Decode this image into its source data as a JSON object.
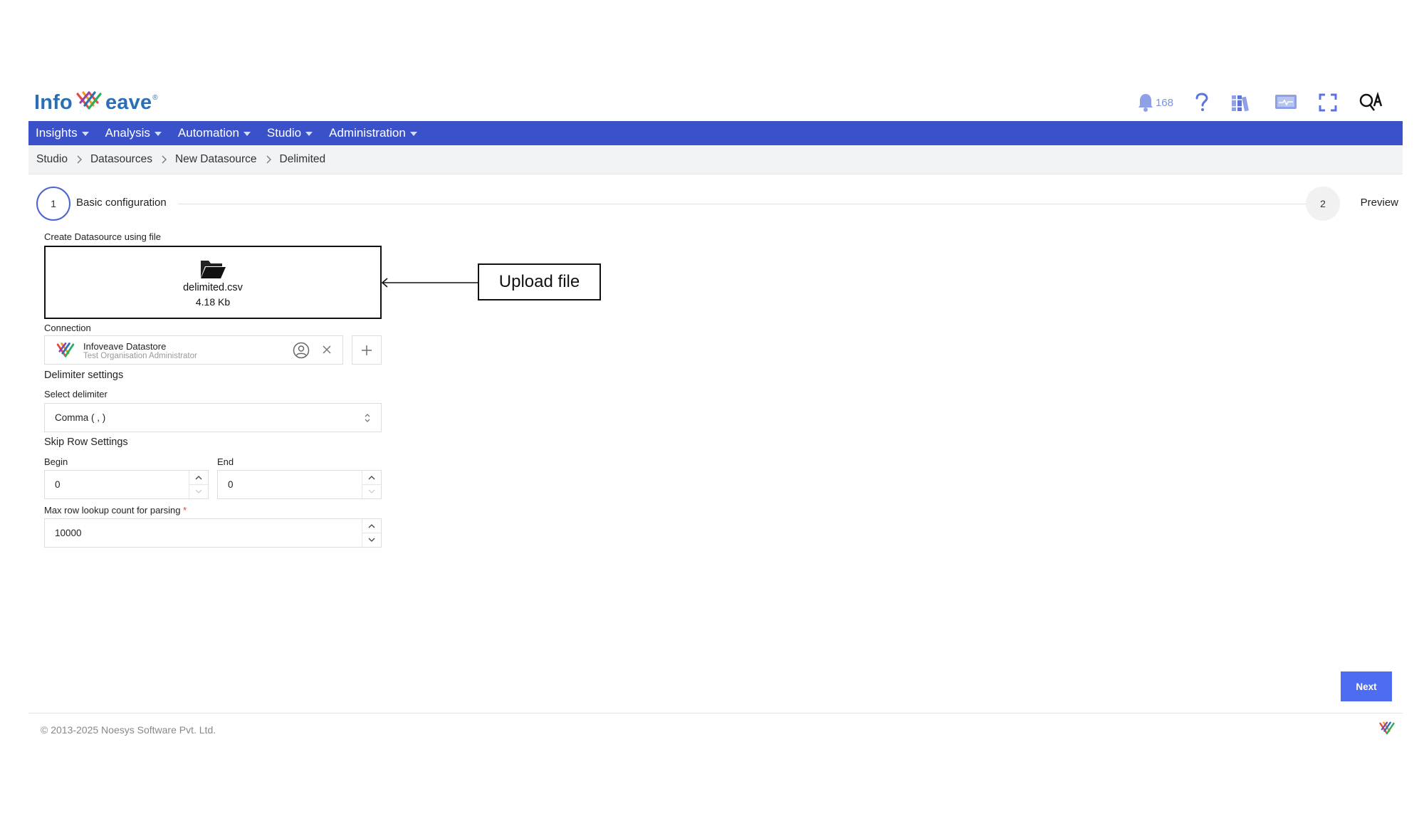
{
  "header": {
    "logo_text_left": "Info",
    "logo_text_right": "eave",
    "logo_reg": "®",
    "notification_count": "168"
  },
  "nav": {
    "items": [
      {
        "label": "Insights"
      },
      {
        "label": "Analysis"
      },
      {
        "label": "Automation"
      },
      {
        "label": "Studio"
      },
      {
        "label": "Administration"
      }
    ]
  },
  "breadcrumb": [
    "Studio",
    "Datasources",
    "New Datasource",
    "Delimited"
  ],
  "stepper": {
    "step1_number": "1",
    "step1_label": "Basic configuration",
    "step2_number": "2",
    "step2_label": "Preview"
  },
  "form": {
    "upload_label": "Create Datasource using file",
    "file_name": "delimited.csv",
    "file_size": "4.18 Kb",
    "connection_label": "Connection",
    "connection_name": "Infoveave Datastore",
    "connection_owner": "Test Organisation Administrator",
    "delimiter_settings_title": "Delimiter settings",
    "select_delimiter_label": "Select delimiter",
    "select_delimiter_value": "Comma ( , )",
    "skip_row_title": "Skip Row Settings",
    "begin_label": "Begin",
    "begin_value": "0",
    "end_label": "End",
    "end_value": "0",
    "max_row_label": "Max row lookup count for parsing",
    "max_row_required": "*",
    "max_row_value": "10000"
  },
  "annotation": {
    "text": "Upload file"
  },
  "actions": {
    "next_label": "Next"
  },
  "footer": {
    "copyright": "© 2013-2025 Noesys Software Pvt. Ltd."
  },
  "colors": {
    "nav_bg": "#3a51c9",
    "accent": "#4c63d2",
    "next_button": "#4d6cf0",
    "required": "#e53935"
  }
}
